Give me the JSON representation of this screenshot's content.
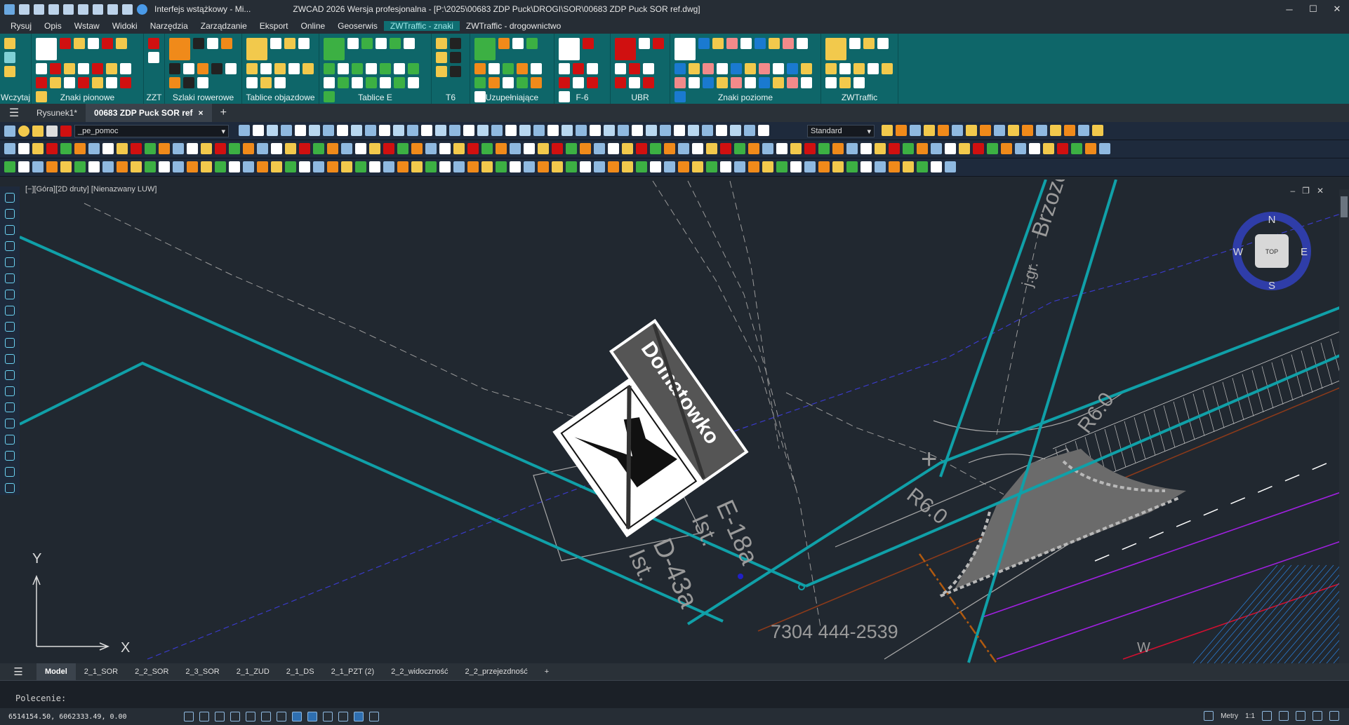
{
  "titlebar": {
    "workspace": "Interfejs wstążkowy - Mi...",
    "title": "ZWCAD 2026 Wersja profesjonalna - [P:\\2025\\00683 ZDP Puck\\DROGI\\SOR\\00683 ZDP Puck SOR ref.dwg]",
    "minimize": "─",
    "maximize": "☐",
    "close": "✕"
  },
  "menu": {
    "items": [
      "Rysuj",
      "Opis",
      "Wstaw",
      "Widoki",
      "Narzędzia",
      "Zarządzanie",
      "Eksport",
      "Online",
      "Geoserwis",
      "ZWTraffic - znaki",
      "ZWTraffic - drogownictwo"
    ],
    "active_index": 9
  },
  "ribbon": {
    "groups": [
      "Wczytaj",
      "Znaki pionowe",
      "ZZT",
      "Szlaki rowerowe",
      "Tablice objazdowe",
      "Tablice E",
      "T6",
      "Uzupełniające",
      "F-6",
      "UBR",
      "Znaki poziome",
      "ZWTraffic"
    ]
  },
  "doc_tabs": {
    "tabs": [
      "Rysunek1*",
      "00683 ZDP Puck SOR ref"
    ],
    "active_index": 1,
    "close_glyph": "×",
    "add_glyph": "+"
  },
  "toolbar": {
    "layer": "_pe_pomoc",
    "style": "Standard"
  },
  "viewport": {
    "label": "[−][Góra][2D druty] [Nienazwany LUW]",
    "compass": {
      "n": "N",
      "s": "S",
      "e": "E",
      "w": "W",
      "top": "TOP"
    },
    "ucs": {
      "x": "X",
      "y": "Y"
    },
    "drawing_text": {
      "sign_label": "Domatowko",
      "street": "Brzozowa",
      "boundary": "j.gr.",
      "e18a": "E-18a",
      "ist1": "Ist.",
      "d43a": "D-43a",
      "ist2": "Ist.",
      "r6_upper": "R6.0",
      "r6_lower": "R6.0",
      "phone": "7304 444-2539",
      "w_label": "W"
    }
  },
  "layout_tabs": {
    "tabs": [
      "Model",
      "2_1_SOR",
      "2_2_SOR",
      "2_3_SOR",
      "2_1_ZUD",
      "2_1_DS",
      "2_1_PZT (2)",
      "2_2_widoczność",
      "2_2_przejezdność"
    ],
    "active_index": 0,
    "add_glyph": "+"
  },
  "command": {
    "prompt": "Polecenie:"
  },
  "status": {
    "coords": "6514154.50, 6062333.49, 0.00",
    "units": "Metry",
    "scale": "1:1"
  },
  "colors": {
    "ribbon": "#0e6669",
    "canvas": "#212830",
    "road": "#10a0a8",
    "sign_border": "#ffffff"
  }
}
